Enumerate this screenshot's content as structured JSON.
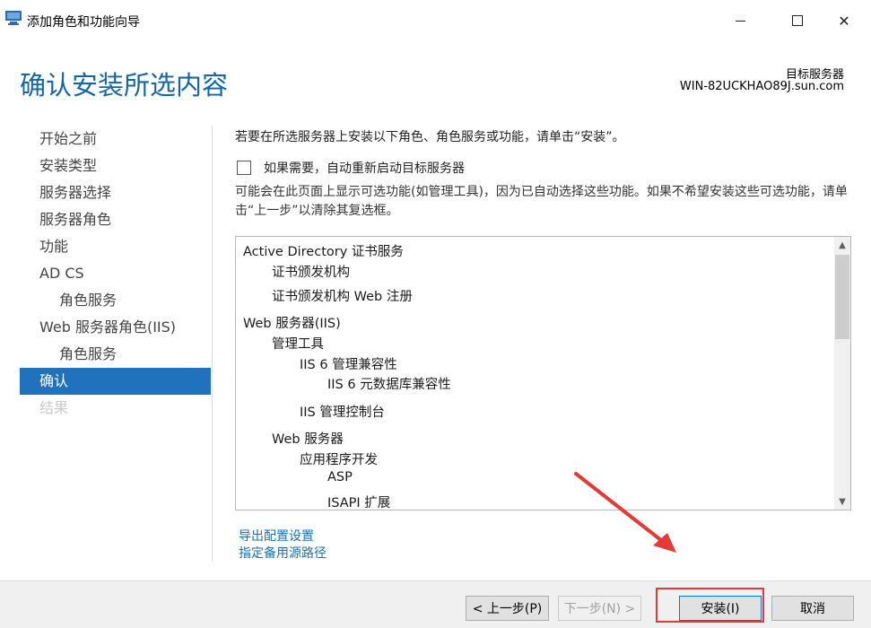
{
  "window": {
    "title": "添加角色和功能向导",
    "controls": {
      "minimize": "minimize",
      "maximize": "maximize",
      "close": "✕"
    }
  },
  "header": {
    "page_title": "确认安装所选内容",
    "destination_label": "目标服务器",
    "destination_server": "WIN-82UCKHAO89J.sun.com"
  },
  "nav": {
    "items": [
      {
        "label": "开始之前",
        "state": "normal"
      },
      {
        "label": "安装类型",
        "state": "normal"
      },
      {
        "label": "服务器选择",
        "state": "normal"
      },
      {
        "label": "服务器角色",
        "state": "normal"
      },
      {
        "label": "功能",
        "state": "normal"
      },
      {
        "label": "AD CS",
        "state": "normal"
      },
      {
        "label": "角色服务",
        "state": "normal"
      },
      {
        "label": "Web 服务器角色(IIS)",
        "state": "normal"
      },
      {
        "label": "角色服务",
        "state": "normal"
      },
      {
        "label": "确认",
        "state": "active"
      },
      {
        "label": "结果",
        "state": "disabled"
      }
    ]
  },
  "content": {
    "intro": "若要在所选服务器上安装以下角色、角色服务或功能，请单击“安装”。",
    "restart_checkbox": {
      "label": "如果需要，自动重新启动目标服务器",
      "checked": false
    },
    "note": "可能会在此页面上显示可选功能(如管理工具)，因为已自动选择这些功能。如果不希望安装这些可选功能，请单击“上一步”以清除其复选框。",
    "features": [
      {
        "label": "Active Directory 证书服务"
      },
      {
        "label": "证书颁发机构"
      },
      {
        "label": "证书颁发机构 Web 注册"
      },
      {
        "label": "Web 服务器(IIS)"
      },
      {
        "label": "管理工具"
      },
      {
        "label": "IIS 6 管理兼容性"
      },
      {
        "label": "IIS 6 元数据库兼容性"
      },
      {
        "label": "IIS 管理控制台"
      },
      {
        "label": "Web 服务器"
      },
      {
        "label": "应用程序开发"
      },
      {
        "label": "ASP"
      },
      {
        "label": "ISAPI 扩展"
      }
    ],
    "links": {
      "export": "导出配置设置",
      "alternate_source": "指定备用源路径"
    }
  },
  "footer": {
    "prev_label": "< 上一步(P)",
    "next_label": "下一步(N) >",
    "install_label": "安装(I)",
    "cancel_label": "取消"
  },
  "colors": {
    "title_blue": "#1566a7",
    "nav_active_bg": "#1f72bb",
    "link": "#1a6fb5",
    "annotation_red": "#e53935"
  },
  "icons": {
    "app": "server-manager-icon",
    "scroll_up": "chevron-up-icon",
    "scroll_down": "chevron-down-icon"
  }
}
